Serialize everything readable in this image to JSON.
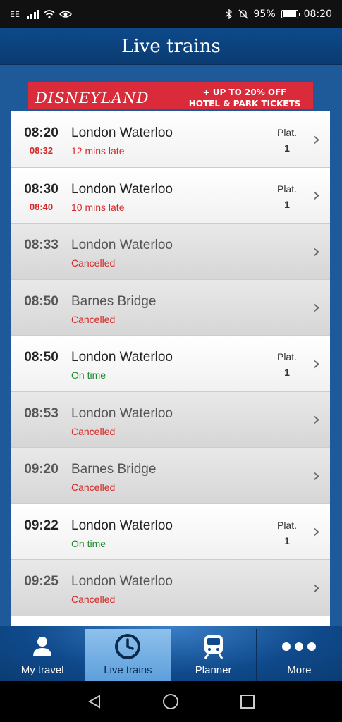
{
  "status_bar": {
    "carrier": "EE",
    "battery": "95%",
    "time": "08:20"
  },
  "header": {
    "title": "Live trains"
  },
  "ad": {
    "brand": "DISNEYLAND",
    "offer_line1": "+ UP TO 20% OFF",
    "offer_line2": "HOTEL & PARK TICKETS"
  },
  "trains": [
    {
      "time": "08:20",
      "expected": "08:32",
      "destination": "London Waterloo",
      "status": "12 mins late",
      "status_type": "late",
      "plat_label": "Plat.",
      "platform": "1",
      "active": true
    },
    {
      "time": "08:30",
      "expected": "08:40",
      "destination": "London Waterloo",
      "status": "10 mins late",
      "status_type": "late",
      "plat_label": "Plat.",
      "platform": "1",
      "active": true
    },
    {
      "time": "08:33",
      "expected": "",
      "destination": "London Waterloo",
      "status": "Cancelled",
      "status_type": "cancelled",
      "plat_label": "",
      "platform": "",
      "active": false
    },
    {
      "time": "08:50",
      "expected": "",
      "destination": "Barnes Bridge",
      "status": "Cancelled",
      "status_type": "cancelled",
      "plat_label": "",
      "platform": "",
      "active": false
    },
    {
      "time": "08:50",
      "expected": "",
      "destination": "London Waterloo",
      "status": "On time",
      "status_type": "ontime",
      "plat_label": "Plat.",
      "platform": "1",
      "active": true
    },
    {
      "time": "08:53",
      "expected": "",
      "destination": "London Waterloo",
      "status": "Cancelled",
      "status_type": "cancelled",
      "plat_label": "",
      "platform": "",
      "active": false
    },
    {
      "time": "09:20",
      "expected": "",
      "destination": "Barnes Bridge",
      "status": "Cancelled",
      "status_type": "cancelled",
      "plat_label": "",
      "platform": "",
      "active": false
    },
    {
      "time": "09:22",
      "expected": "",
      "destination": "London Waterloo",
      "status": "On time",
      "status_type": "ontime",
      "plat_label": "Plat.",
      "platform": "1",
      "active": true
    },
    {
      "time": "09:25",
      "expected": "",
      "destination": "London Waterloo",
      "status": "Cancelled",
      "status_type": "cancelled",
      "plat_label": "",
      "platform": "",
      "active": false
    }
  ],
  "tabs": [
    {
      "label": "My travel",
      "icon": "person-icon",
      "selected": false
    },
    {
      "label": "Live trains",
      "icon": "clock-icon",
      "selected": true
    },
    {
      "label": "Planner",
      "icon": "train-icon",
      "selected": false
    },
    {
      "label": "More",
      "icon": "more-dots-icon",
      "selected": false
    }
  ],
  "nav": [
    "back-icon",
    "home-icon",
    "recents-icon"
  ],
  "colors": {
    "late": "#d62828",
    "ontime": "#1d8a2c",
    "header": "#0d4a8a",
    "ad": "#d92b3a"
  }
}
